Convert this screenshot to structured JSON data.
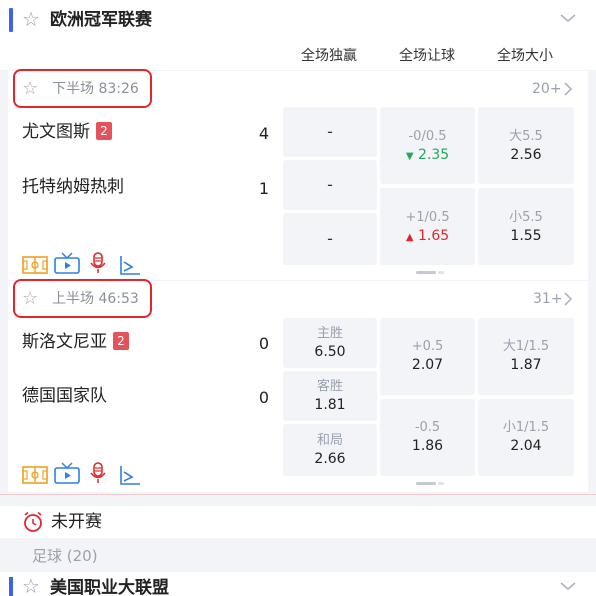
{
  "league": {
    "title": "欧洲冠军联赛",
    "star_icon": "star-outline-icon",
    "expand_icon": "chevron-down-icon"
  },
  "columns": [
    "全场独赢",
    "全场让球",
    "全场大小"
  ],
  "matches": [
    {
      "status": "下半场 83:26",
      "more": "20+",
      "home": {
        "name": "尤文图斯",
        "red_cards": "2",
        "score": "4"
      },
      "away": {
        "name": "托特纳姆热刺",
        "score": "1"
      },
      "moneyline": [
        "-",
        "-",
        "-"
      ],
      "handicap": [
        {
          "line": "-0/0.5",
          "odds": "2.35",
          "trend": "down"
        },
        {
          "line": "+1/0.5",
          "odds": "1.65",
          "trend": "up"
        }
      ],
      "totals": [
        {
          "line": "大5.5",
          "odds": "2.56"
        },
        {
          "line": "小5.5",
          "odds": "1.55"
        }
      ],
      "icons": [
        "pitch-icon",
        "tv-icon",
        "mic-icon",
        "stats-icon"
      ]
    },
    {
      "status": "上半场 46:53",
      "more": "31+",
      "home": {
        "name": "斯洛文尼亚",
        "red_cards": "2",
        "score": "0"
      },
      "away": {
        "name": "德国国家队",
        "score": "0"
      },
      "moneyline": [
        {
          "label": "主胜",
          "odds": "6.50"
        },
        {
          "label": "客胜",
          "odds": "1.81"
        },
        {
          "label": "和局",
          "odds": "2.66"
        }
      ],
      "handicap": [
        {
          "line": "+0.5",
          "odds": "2.07"
        },
        {
          "line": "-0.5",
          "odds": "1.86"
        }
      ],
      "totals": [
        {
          "line": "大1/1.5",
          "odds": "1.87"
        },
        {
          "line": "小1/1.5",
          "odds": "2.04"
        }
      ],
      "icons": [
        "pitch-icon",
        "tv-icon",
        "mic-icon",
        "stats-icon"
      ]
    }
  ],
  "upcoming": {
    "title": "未开赛",
    "icon": "alarm-clock-icon",
    "sport": "足球 (20)"
  },
  "next_league": {
    "title": "美国职业大联盟"
  },
  "colors": {
    "accent": "#3f63e6",
    "highlight_red": "#e2262b",
    "up_green": "#25a85b"
  }
}
